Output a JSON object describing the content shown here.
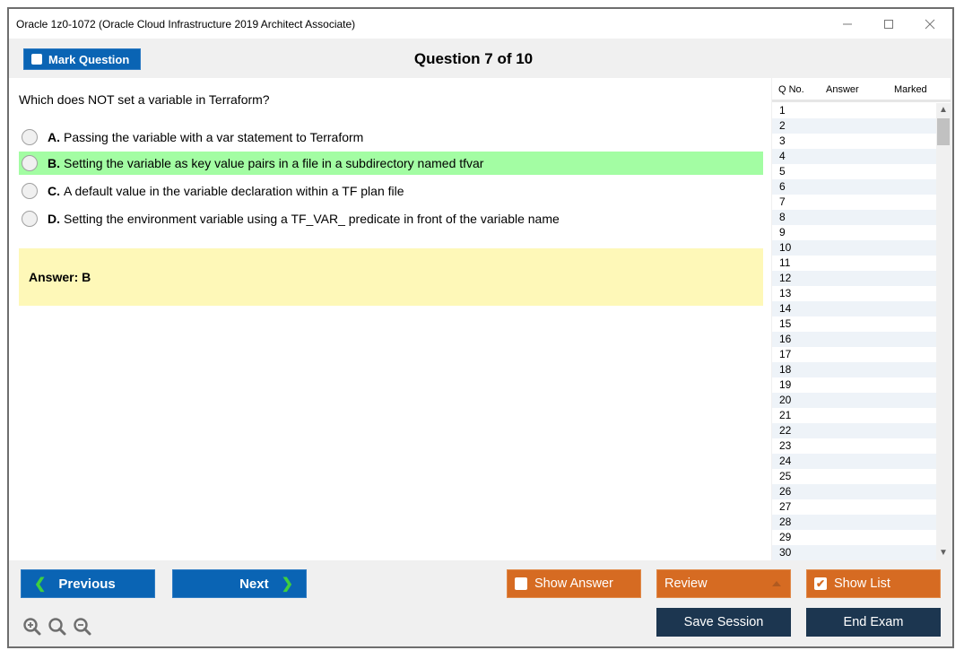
{
  "window": {
    "title": "Oracle 1z0-1072 (Oracle Cloud Infrastructure 2019 Architect Associate)",
    "controls": [
      "minimize-icon",
      "maximize-icon",
      "close-icon"
    ]
  },
  "header": {
    "mark_question_label": "Mark Question",
    "question_counter": "Question 7 of 10"
  },
  "question": {
    "text": "Which does NOT set a variable in Terraform?",
    "options": [
      {
        "letter": "A.",
        "text": "Passing the variable with a var statement to Terraform",
        "highlighted": false
      },
      {
        "letter": "B.",
        "text": "Setting the variable as key value pairs in a file in a subdirectory named tfvar",
        "highlighted": true
      },
      {
        "letter": "C.",
        "text": "A default value in the variable declaration within a TF plan file",
        "highlighted": false
      },
      {
        "letter": "D.",
        "text": "Setting the environment variable using a TF_VAR_ predicate in front of the variable name",
        "highlighted": false
      }
    ],
    "answer": "Answer: B"
  },
  "question_list": {
    "columns": [
      "Q No.",
      "Answer",
      "Marked"
    ],
    "rows": [
      "1",
      "2",
      "3",
      "4",
      "5",
      "6",
      "7",
      "8",
      "9",
      "10",
      "11",
      "12",
      "13",
      "14",
      "15",
      "16",
      "17",
      "18",
      "19",
      "20",
      "21",
      "22",
      "23",
      "24",
      "25",
      "26",
      "27",
      "28",
      "29",
      "30"
    ]
  },
  "footer": {
    "previous_label": "Previous",
    "next_label": "Next",
    "show_answer_label": "Show Answer",
    "show_answer_checked": false,
    "review_label": "Review",
    "show_list_label": "Show List",
    "show_list_checked": true,
    "save_session_label": "Save Session",
    "end_exam_label": "End Exam",
    "zoom_icons": [
      "zoom-in-icon",
      "zoom-reset-icon",
      "zoom-out-icon"
    ]
  },
  "colors": {
    "primary_blue": "#0a64b4",
    "accent_orange": "#d66b22",
    "dark_navy": "#1c3650",
    "correct_highlight": "#a3fda3",
    "answer_background": "#fef8b8",
    "chevron_green": "#3fcf3f"
  }
}
